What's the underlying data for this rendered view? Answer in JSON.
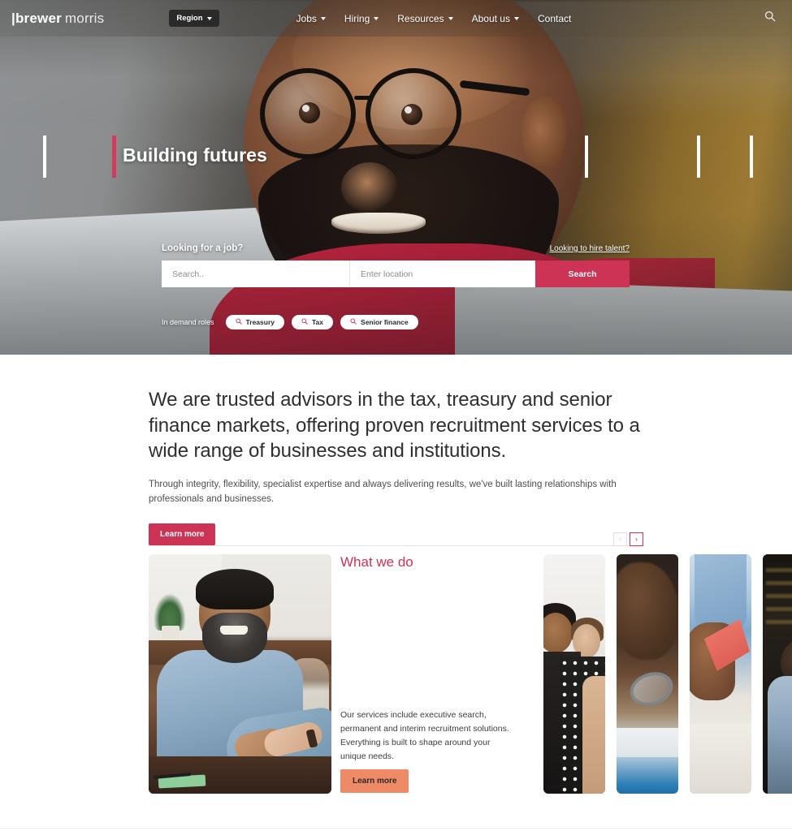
{
  "header": {
    "logo": {
      "bar": "|",
      "word1": "brewer",
      "word2": "morris"
    },
    "region_label": "Region",
    "nav": [
      {
        "label": "Jobs",
        "has_caret": true
      },
      {
        "label": "Hiring",
        "has_caret": true
      },
      {
        "label": "Resources",
        "has_caret": true
      },
      {
        "label": "About us",
        "has_caret": true
      },
      {
        "label": "Contact",
        "has_caret": false
      }
    ],
    "search_icon": "search-icon"
  },
  "hero": {
    "title": "Building futures",
    "search": {
      "label": "Looking for a job?",
      "hire_link": "Looking to hire talent?",
      "keyword_placeholder": "Search..",
      "location_placeholder": "Enter location",
      "button_label": "Search"
    },
    "roles": {
      "label": "In demand roles",
      "chips": [
        "Treasury",
        "Tax",
        "Senior finance"
      ]
    }
  },
  "intro": {
    "headline": "We are trusted advisors in the tax, treasury and senior finance markets, offering proven recruitment services to a wide range of businesses and institutions.",
    "paragraph": "Through integrity, flexibility, specialist expertise and always delivering results, we've built lasting relationships with professionals and businesses.",
    "cta_label": "Learn more"
  },
  "carousel": {
    "prev_label": "‹",
    "next_label": "›"
  },
  "what_we_do": {
    "title": "What we do",
    "body": "Our services include executive search, permanent and interim recruitment solutions. Everything is built to shape around your unique needs.",
    "cta_label": "Learn more"
  },
  "colors": {
    "crimson": "#cc3355",
    "salmon": "#ef8a66",
    "pink_muted": "#e9c3cd"
  }
}
